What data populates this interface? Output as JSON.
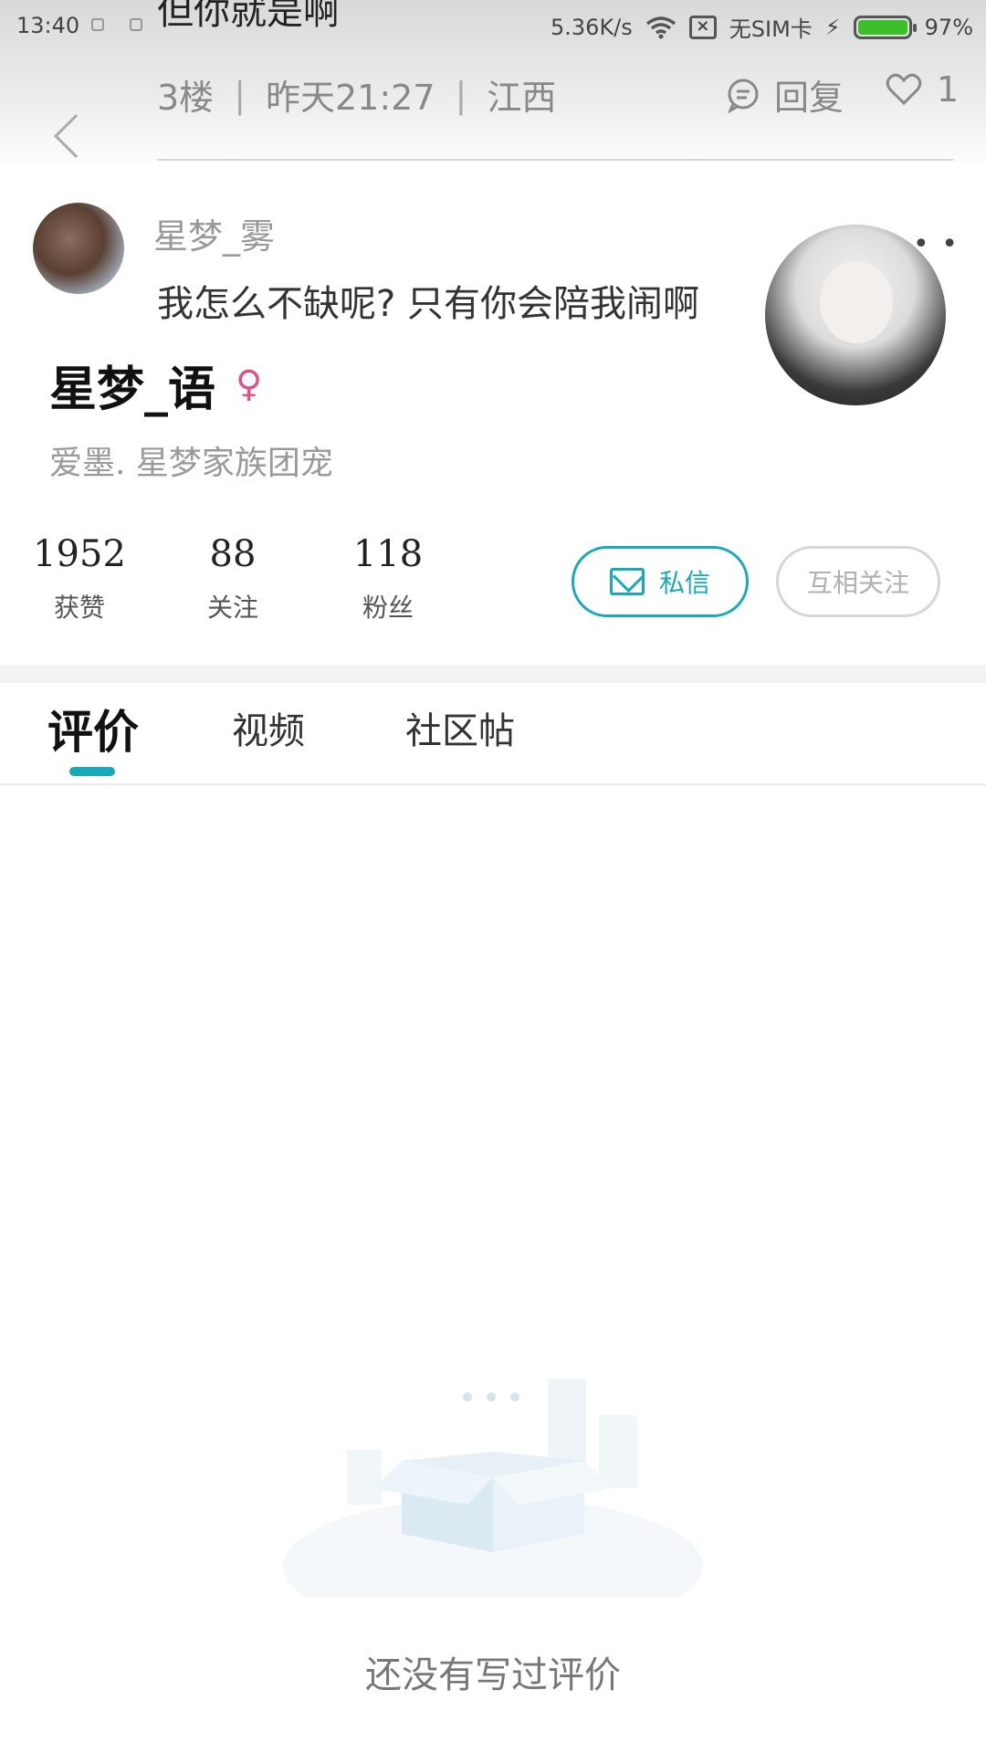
{
  "status_bar": {
    "time": "13:40",
    "network_speed": "5.36K/s",
    "sim_status": "无SIM卡",
    "battery": "97%",
    "battery_level": 0.97
  },
  "post_overlay": {
    "title_fragment": "但你就是啊",
    "floor": "3楼",
    "time": "昨天21:27",
    "location": "江西",
    "reply_label": "回复",
    "like_count": "1"
  },
  "comment": {
    "author": "星梦_雾",
    "text": "我怎么不缺呢? 只有你会陪我闹啊"
  },
  "profile": {
    "name": "星梦_语",
    "gender_symbol": "♀",
    "bio": "爱墨. 星梦家族团宠",
    "stats": [
      {
        "value": "1952",
        "label": "获赞"
      },
      {
        "value": "88",
        "label": "关注"
      },
      {
        "value": "118",
        "label": "粉丝"
      }
    ],
    "message_button": "私信",
    "follow_button": "互相关注"
  },
  "tabs": [
    {
      "label": "评价",
      "active": true
    },
    {
      "label": "视频",
      "active": false
    },
    {
      "label": "社区帖",
      "active": false
    }
  ],
  "empty_state": {
    "text": "还没有写过评价"
  },
  "colors": {
    "accent": "#1aa9b8",
    "gender_female": "#e0508a",
    "battery_green": "#3cbf2b"
  }
}
